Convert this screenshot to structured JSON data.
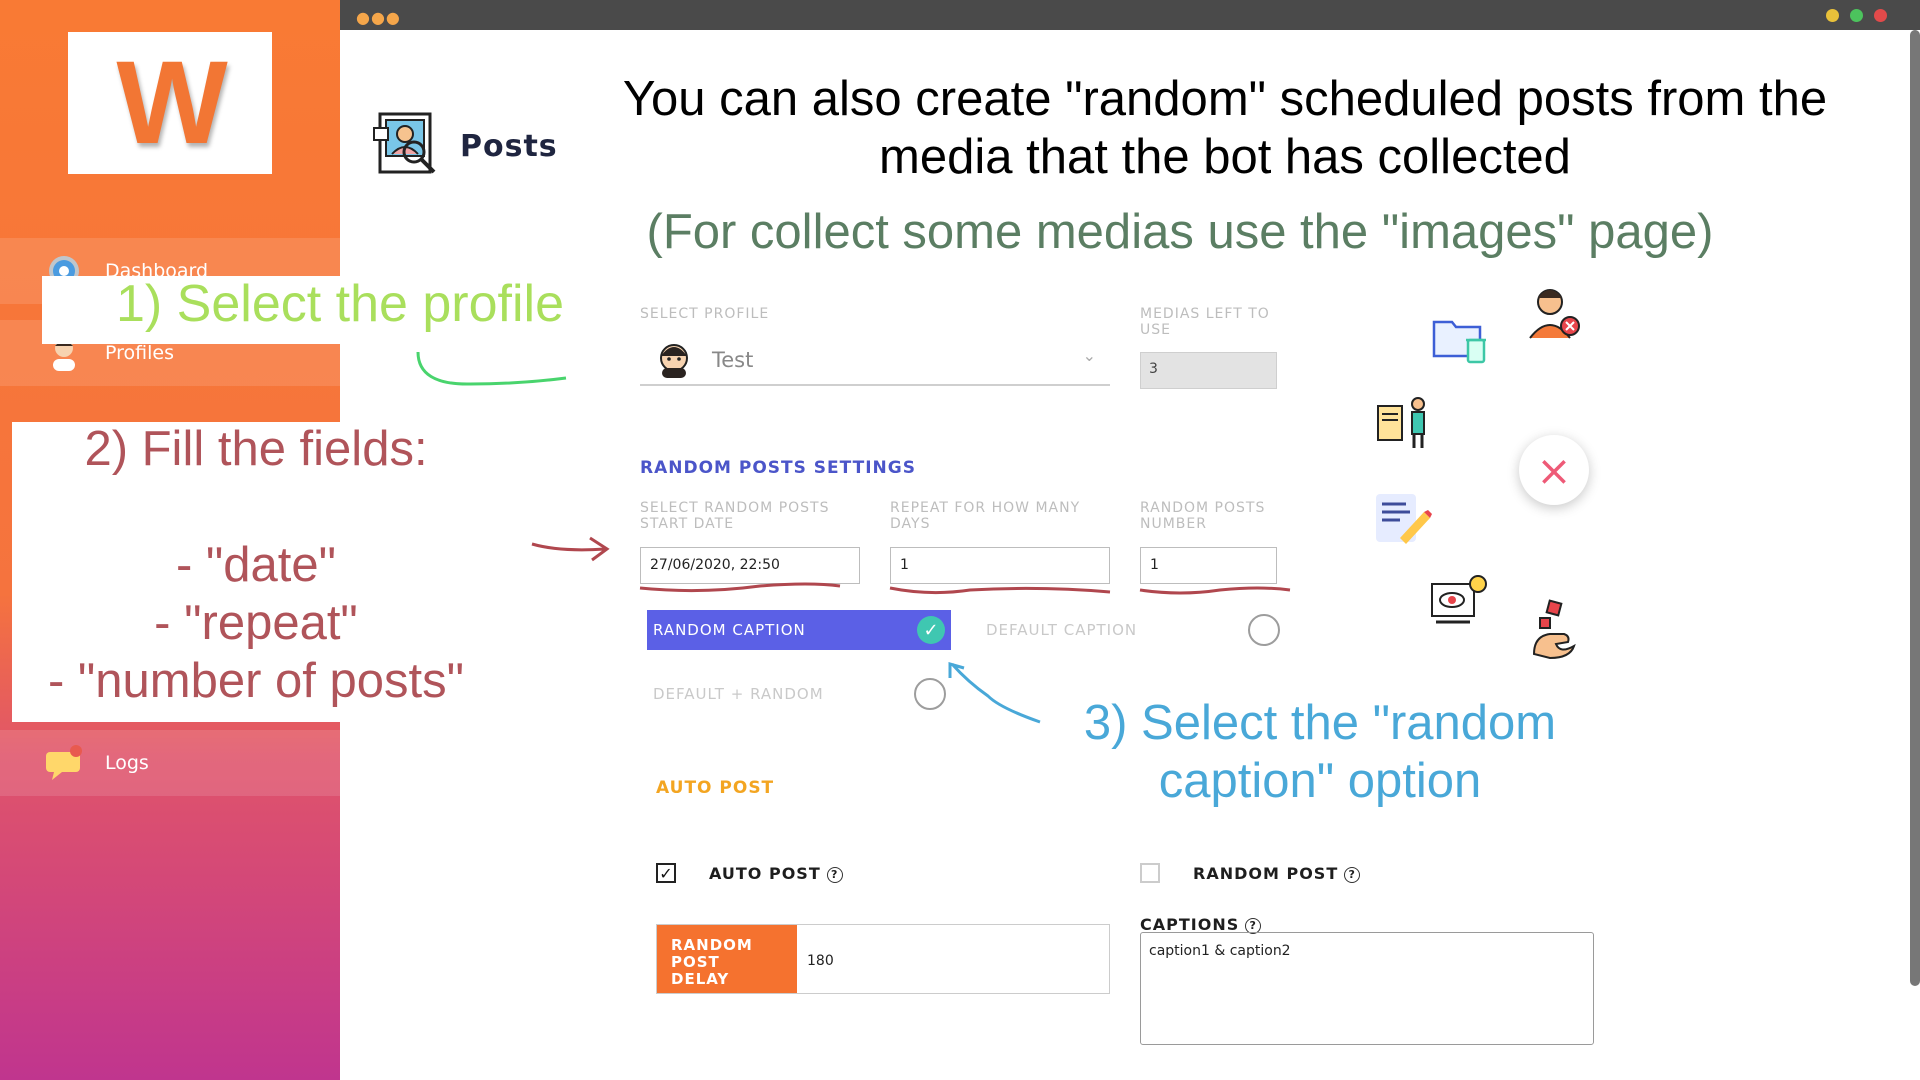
{
  "sidebar": {
    "logo_letter": "W",
    "items": [
      {
        "label": "Dashboard",
        "icon": "gear-icon"
      },
      {
        "label": "Profiles",
        "icon": "user-icon"
      },
      {
        "label": "Logs",
        "icon": "chat-bubble-icon"
      }
    ]
  },
  "page": {
    "title": "Posts",
    "headline": "You can also create \"random\" scheduled posts from the media that the bot has collected",
    "subhead": "(For collect some medias use the \"images\" page)"
  },
  "profile": {
    "select_label": "SELECT PROFILE",
    "selected": "Test",
    "medias_label": "MEDIAS LEFT TO USE",
    "medias_value": "3"
  },
  "random_settings": {
    "section_title": "RANDOM POSTS SETTINGS",
    "start_date_label": "SELECT RANDOM POSTS START DATE",
    "start_date_value": "27/06/2020, 22:50",
    "repeat_label": "REPEAT FOR HOW MANY DAYS",
    "repeat_value": "1",
    "number_label": "RANDOM POSTS NUMBER",
    "number_value": "1",
    "random_caption": "RANDOM CAPTION",
    "default_caption": "DEFAULT CAPTION",
    "default_random": "DEFAULT + RANDOM"
  },
  "auto_post": {
    "section_title": "AUTO POST",
    "auto_post_label": "AUTO POST",
    "auto_post_checked": true,
    "random_post_label": "RANDOM POST",
    "random_post_checked": false,
    "delay_label": "RANDOM POST DELAY",
    "delay_value": "180",
    "captions_label": "CAPTIONS",
    "captions_value": "caption1 & caption2"
  },
  "annotations": {
    "step1": "1) Select the profile",
    "step2": "2) Fill the fields:\n\n- \"date\"\n- \"repeat\"\n- \"number of posts\"",
    "step3": "3) Select the \"random caption\" option"
  },
  "colors": {
    "accent_orange": "#f5722f",
    "accent_blue": "#5b60e6",
    "section_blue": "#4b55c9",
    "section_orange": "#f3a521",
    "check_green": "#3fc7b1",
    "fab_pink": "#ee5a77"
  },
  "fab": {
    "icon": "close-icon"
  }
}
